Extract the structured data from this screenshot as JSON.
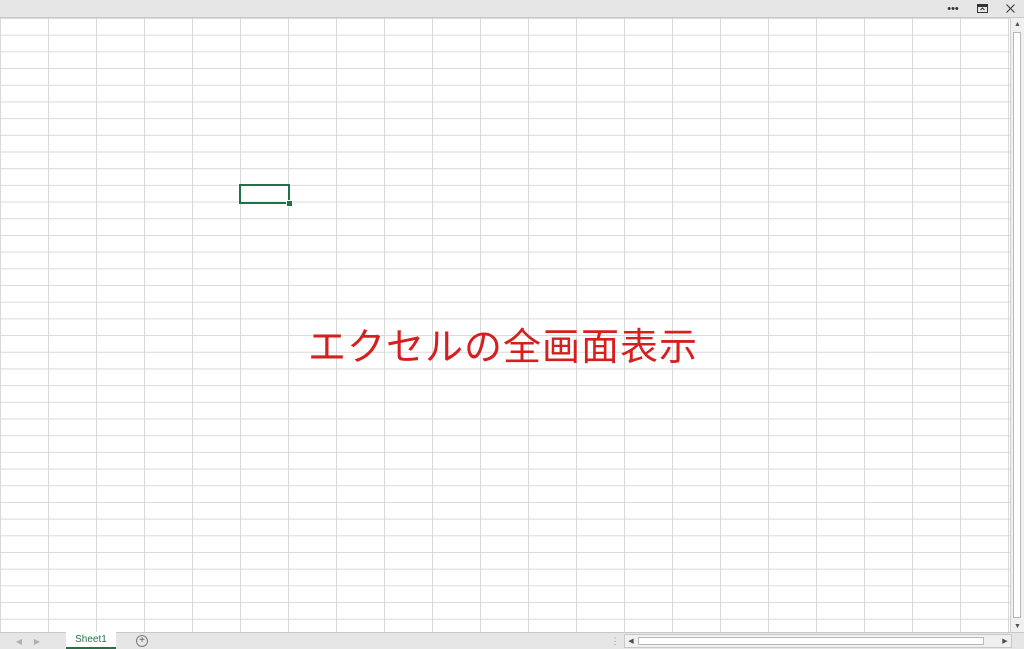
{
  "window": {
    "ribbon_options_icon": "ellipsis-icon",
    "restore_icon": "restore-ribbon-icon",
    "close_icon": "close-icon"
  },
  "caption": {
    "text": "エクセルの全画面表示",
    "color": "#d61f1f"
  },
  "grid": {
    "accent_color": "#217346",
    "gridline_color": "#d9d9d9"
  },
  "sheets": {
    "tabs": [
      {
        "label": "Sheet1",
        "active": true
      }
    ],
    "add_sheet_icon": "plus-circle-icon"
  }
}
